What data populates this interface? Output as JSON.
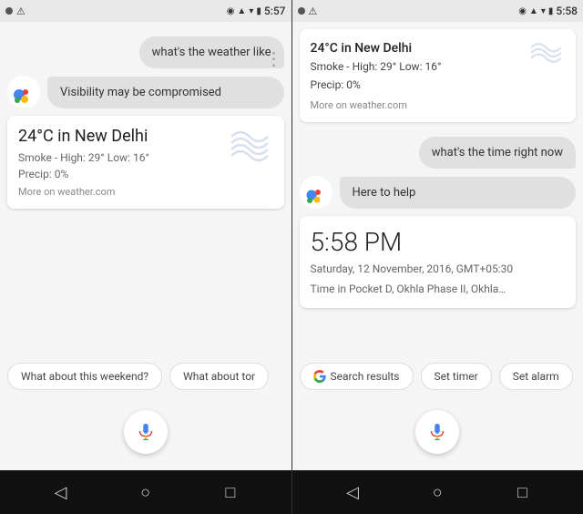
{
  "screen1": {
    "status_bar": {
      "left_icons": [
        "alert-icon",
        "triangle-icon"
      ],
      "time": "5:57",
      "right_icons": [
        "location-icon",
        "signal-icon",
        "wifi-icon",
        "battery-icon"
      ]
    },
    "user_message": "what's the weather like",
    "assistant_message": "Visibility may be compromised",
    "weather": {
      "title": "24°C in New Delhi",
      "smoke": "Smoke - High: 29° Low: 16°",
      "precip": "Precip: 0%",
      "link": "More on weather.com"
    },
    "chips": [
      {
        "label": "What about this weekend?",
        "has_g": false
      },
      {
        "label": "What about tor",
        "has_g": false
      }
    ]
  },
  "screen2": {
    "status_bar": {
      "left_icons": [
        "alert-icon",
        "triangle-icon"
      ],
      "time": "5:58",
      "right_icons": [
        "location-icon",
        "signal-icon",
        "wifi-icon",
        "battery-icon"
      ]
    },
    "weather_top": {
      "title": "24°C in New Delhi",
      "smoke": "Smoke - High: 29° Low: 16°",
      "precip": "Precip: 0%",
      "link": "More on weather.com"
    },
    "user_message": "what's the time right now",
    "assistant_message": "Here to help",
    "time_card": {
      "time": "5:58 PM",
      "date": "Saturday, 12 November, 2016, GMT+05:30",
      "location": "Time in Pocket D, Okhla Phase II, Okhla…"
    },
    "chips": [
      {
        "label": "Search results",
        "has_g": true
      },
      {
        "label": "Set timer",
        "has_g": false
      },
      {
        "label": "Set alarm",
        "has_g": false
      }
    ]
  },
  "nav": {
    "back_label": "◁",
    "home_label": "○",
    "recent_label": "□"
  }
}
